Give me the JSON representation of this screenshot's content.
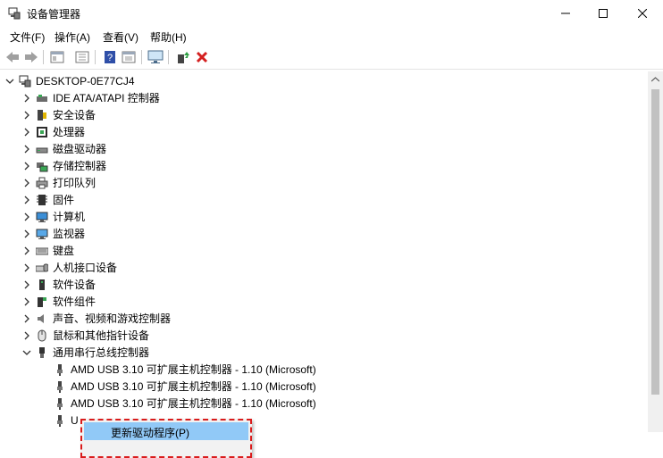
{
  "window": {
    "title": "设备管理器"
  },
  "menu": [
    {
      "label": "文件(F)"
    },
    {
      "label": "操作(A)"
    },
    {
      "label": "查看(V)"
    },
    {
      "label": "帮助(H)"
    }
  ],
  "toolbar": {
    "icons": [
      "back-arrow-icon",
      "forward-arrow-icon",
      "properties-window-icon",
      "list-view-icon",
      "help-icon",
      "resource-view-icon",
      "monitor-scan-icon",
      "update-driver-icon",
      "uninstall-x-icon"
    ]
  },
  "tree": {
    "root": "DESKTOP-0E77CJ4",
    "categories": [
      {
        "label": "IDE ATA/ATAPI 控制器",
        "icon": "ide-controller-icon"
      },
      {
        "label": "安全设备",
        "icon": "security-device-icon"
      },
      {
        "label": "处理器",
        "icon": "processor-icon"
      },
      {
        "label": "磁盘驱动器",
        "icon": "disk-drive-icon"
      },
      {
        "label": "存储控制器",
        "icon": "storage-controller-icon"
      },
      {
        "label": "打印队列",
        "icon": "printer-icon"
      },
      {
        "label": "固件",
        "icon": "firmware-icon"
      },
      {
        "label": "计算机",
        "icon": "computer-icon"
      },
      {
        "label": "监视器",
        "icon": "monitor-icon"
      },
      {
        "label": "键盘",
        "icon": "keyboard-icon"
      },
      {
        "label": "人机接口设备",
        "icon": "hid-icon"
      },
      {
        "label": "软件设备",
        "icon": "software-device-icon"
      },
      {
        "label": "软件组件",
        "icon": "software-component-icon"
      },
      {
        "label": "声音、视频和游戏控制器",
        "icon": "sound-icon"
      },
      {
        "label": "鼠标和其他指针设备",
        "icon": "mouse-icon"
      },
      {
        "label": "通用串行总线控制器",
        "icon": "usb-icon"
      }
    ],
    "usb_children": [
      {
        "label": "AMD USB 3.10 可扩展主机控制器 - 1.10 (Microsoft)"
      },
      {
        "label": "AMD USB 3.10 可扩展主机控制器 - 1.10 (Microsoft)"
      },
      {
        "label": "AMD USB 3.10 可扩展主机控制器 - 1.10 (Microsoft)"
      },
      {
        "label": "U"
      }
    ]
  },
  "context_menu": {
    "items": [
      {
        "label": "更新驱动程序(P)"
      }
    ]
  },
  "colors": {
    "selection": "#91c9f7",
    "highlight_border": "#d91c1c",
    "scrollbar_thumb": "#c1c1c1"
  }
}
